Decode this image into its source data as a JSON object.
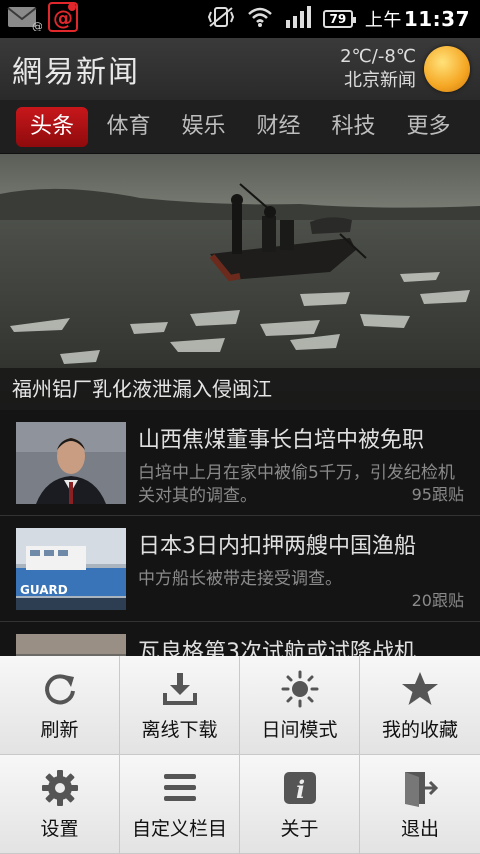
{
  "status_bar": {
    "battery": "79",
    "time_prefix": "上午",
    "time": "11:37"
  },
  "header": {
    "logo": "網易新闻",
    "weather_temp": "2℃/-8℃",
    "weather_location": "北京新闻"
  },
  "tabs": [
    {
      "label": "头条",
      "active": true
    },
    {
      "label": "体育"
    },
    {
      "label": "娱乐"
    },
    {
      "label": "财经"
    },
    {
      "label": "科技"
    },
    {
      "label": "更多"
    }
  ],
  "hero": {
    "caption": "福州铝厂乳化液泄漏入侵闽江"
  },
  "news": [
    {
      "title": "山西焦煤董事长白培中被免职",
      "desc": "白培中上月在家中被偷5千万，引发纪检机关对其的调查。",
      "count": "95跟贴"
    },
    {
      "title": "日本3日内扣押两艘中国渔船",
      "desc": "中方船长被带走接受调查。",
      "count": "20跟贴"
    },
    {
      "title": "瓦良格第3次试航或试降战机"
    }
  ],
  "menu": [
    {
      "label": "刷新",
      "icon": "refresh-icon"
    },
    {
      "label": "离线下载",
      "icon": "download-icon"
    },
    {
      "label": "日间模式",
      "icon": "sun-icon"
    },
    {
      "label": "我的收藏",
      "icon": "star-icon"
    },
    {
      "label": "设置",
      "icon": "gear-icon"
    },
    {
      "label": "自定义栏目",
      "icon": "list-icon"
    },
    {
      "label": "关于",
      "icon": "info-icon"
    },
    {
      "label": "退出",
      "icon": "exit-icon"
    }
  ]
}
